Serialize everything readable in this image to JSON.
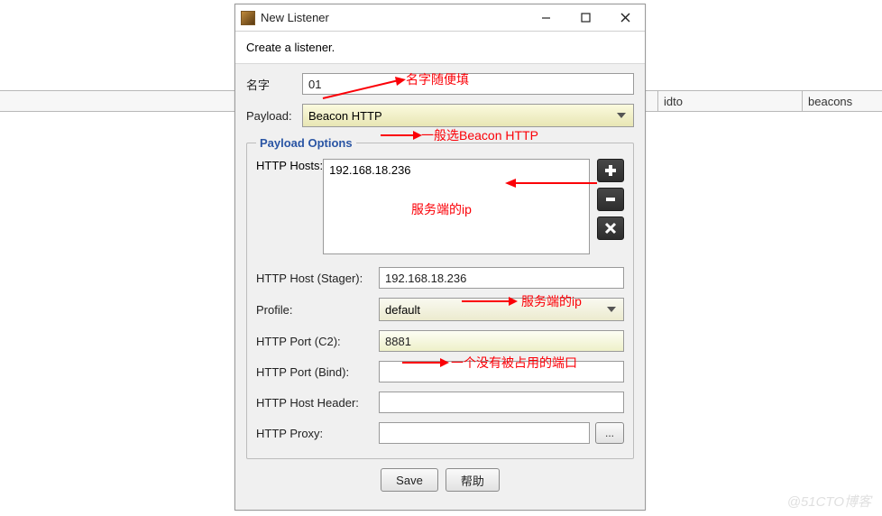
{
  "background_table": {
    "col2": "idto",
    "col3": "beacons"
  },
  "dialog": {
    "title": "New Listener",
    "subheader": "Create a listener.",
    "name_label": "名字",
    "name_value": "01",
    "payload_label": "Payload:",
    "payload_value": "Beacon HTTP",
    "options_legend": "Payload Options",
    "hosts_label": "HTTP Hosts:",
    "hosts_value": "192.168.18.236",
    "host_stager_label": "HTTP Host (Stager):",
    "host_stager_value": "192.168.18.236",
    "profile_label": "Profile:",
    "profile_value": "default",
    "port_c2_label": "HTTP Port (C2):",
    "port_c2_value": "8881",
    "port_bind_label": "HTTP Port (Bind):",
    "port_bind_value": "",
    "host_header_label": "HTTP Host Header:",
    "host_header_value": "",
    "proxy_label": "HTTP Proxy:",
    "proxy_value": "",
    "browse_label": "...",
    "save_label": "Save",
    "help_label": "帮助"
  },
  "annotations": {
    "name_hint": "名字随便填",
    "payload_hint": "一般选Beacon HTTP",
    "hosts_hint": "服务端的ip",
    "stager_hint": "服务端的ip",
    "port_hint": "一个没有被占用的端口"
  },
  "watermark": "@51CTO博客"
}
